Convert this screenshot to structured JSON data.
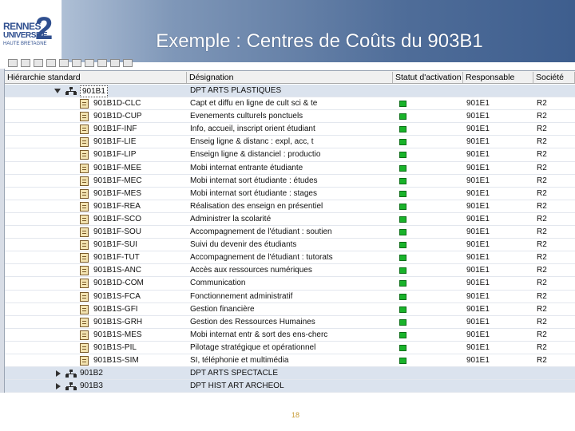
{
  "header": {
    "title": "Exemple : Centres de Coûts du 903B1"
  },
  "logo": {
    "line1": "RENNES",
    "line2": "UNIVERSITÉ",
    "number": "2",
    "subtitle": "HAUTE BRETAGNE"
  },
  "columns": [
    "Hiérarchie standard",
    "Désignation",
    "Statut d'activation",
    "Responsable",
    "Société"
  ],
  "root": {
    "code": "901B1",
    "designation": "DPT ARTS PLASTIQUES"
  },
  "rows": [
    {
      "code": "901B1D-CLC",
      "designation": "Capt et diffu en ligne de cult sci & te",
      "responsable": "901E1",
      "societe": "R2"
    },
    {
      "code": "901B1D-CUP",
      "designation": "Evenements culturels ponctuels",
      "responsable": "901E1",
      "societe": "R2"
    },
    {
      "code": "901B1F-INF",
      "designation": "Info, accueil, inscript orient étudiant",
      "responsable": "901E1",
      "societe": "R2"
    },
    {
      "code": "901B1F-LIE",
      "designation": "Enseig ligne & distanc : expl, acc, t",
      "responsable": "901E1",
      "societe": "R2"
    },
    {
      "code": "901B1F-LIP",
      "designation": "Enseign ligne & distanciel : productio",
      "responsable": "901E1",
      "societe": "R2"
    },
    {
      "code": "901B1F-MEE",
      "designation": "Mobi internat entrante étudiante",
      "responsable": "901E1",
      "societe": "R2"
    },
    {
      "code": "901B1F-MEC",
      "designation": "Mobi internat sort étudiante : études",
      "responsable": "901E1",
      "societe": "R2"
    },
    {
      "code": "901B1F-MES",
      "designation": "Mobi internat sort étudiante : stages",
      "responsable": "901E1",
      "societe": "R2"
    },
    {
      "code": "901B1F-REA",
      "designation": "Réalisation des enseign en présentiel",
      "responsable": "901E1",
      "societe": "R2"
    },
    {
      "code": "901B1F-SCO",
      "designation": "Administrer la scolarité",
      "responsable": "901E1",
      "societe": "R2"
    },
    {
      "code": "901B1F-SOU",
      "designation": "Accompagnement de l'étudiant : soutien",
      "responsable": "901E1",
      "societe": "R2"
    },
    {
      "code": "901B1F-SUI",
      "designation": "Suivi du devenir des étudiants",
      "responsable": "901E1",
      "societe": "R2"
    },
    {
      "code": "901B1F-TUT",
      "designation": "Accompagnement de l'étudiant : tutorats",
      "responsable": "901E1",
      "societe": "R2"
    },
    {
      "code": "901B1S-ANC",
      "designation": "Accès aux ressources numériques",
      "responsable": "901E1",
      "societe": "R2"
    },
    {
      "code": "901B1D-COM",
      "designation": "Communication",
      "responsable": "901E1",
      "societe": "R2"
    },
    {
      "code": "901B1S-FCA",
      "designation": "Fonctionnement administratif",
      "responsable": "901E1",
      "societe": "R2"
    },
    {
      "code": "901B1S-GFI",
      "designation": "Gestion financière",
      "responsable": "901E1",
      "societe": "R2"
    },
    {
      "code": "901B1S-GRH",
      "designation": "Gestion des Ressources Humaines",
      "responsable": "901E1",
      "societe": "R2"
    },
    {
      "code": "901B1S-MES",
      "designation": "Mobi internat entr & sort des ens-cherc",
      "responsable": "901E1",
      "societe": "R2"
    },
    {
      "code": "901B1S-PIL",
      "designation": "Pilotage stratégique et opérationnel",
      "responsable": "901E1",
      "societe": "R2"
    },
    {
      "code": "901B1S-SIM",
      "designation": "SI, téléphonie et multimédia",
      "responsable": "901E1",
      "societe": "R2"
    }
  ],
  "siblings": [
    {
      "code": "901B2",
      "designation": "DPT ARTS SPECTACLE"
    },
    {
      "code": "901B3",
      "designation": "DPT HIST ART ARCHEOL"
    }
  ],
  "status_color": "#19b32a",
  "page_number": "18"
}
